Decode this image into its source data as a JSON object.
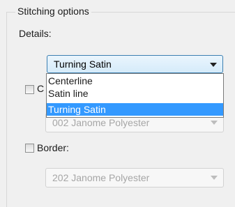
{
  "group": {
    "title": "Stitching options"
  },
  "details": {
    "label": "Details:",
    "selected": "Turning Satin",
    "options": [
      "Centerline",
      "Satin line",
      "Turning Satin"
    ],
    "selected_index": 2
  },
  "color_option": {
    "label_partial": "C",
    "checked": false,
    "thread_value": "002 Janome Polyester"
  },
  "border_option": {
    "label": "Border:",
    "checked": false,
    "thread_value": "202 Janome Polyester"
  },
  "colors": {
    "selection": "#3399ff",
    "combo_active_border": "#3c7fb1",
    "disabled_text": "#a6a6a6"
  }
}
